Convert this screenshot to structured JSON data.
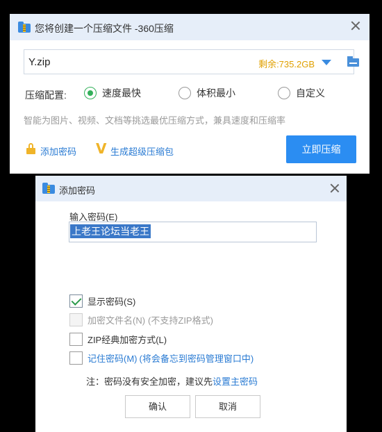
{
  "compress_window": {
    "title": "您将创建一个压缩文件 -360压缩",
    "file_name": "Y.zip",
    "free_space": "剩余:735.2GB",
    "config_label": "压缩配置:",
    "options": [
      "速度最快",
      "体积最小",
      "自定义"
    ],
    "selected_option": "速度最快",
    "description": "智能为图片、视频、文档等挑选最优压缩方式，兼具速度和压缩率",
    "add_password_link": "添加密码",
    "super_package_link": "生成超级压缩包",
    "compress_button": "立即压缩",
    "colors": {
      "accent": "#2b8df2",
      "free_space": "#e0a000",
      "radio_selected": "#33b05a",
      "link": "#2a7bd3"
    }
  },
  "password_dialog": {
    "title": "添加密码",
    "input_label": "输入密码(E)",
    "input_value": "上老王论坛当老王",
    "checkboxes": [
      {
        "label": "显示密码(S)",
        "hint": "",
        "checked": true,
        "enabled": true
      },
      {
        "label": "加密文件名(N)",
        "hint": "(不支持ZIP格式)",
        "checked": false,
        "enabled": false
      },
      {
        "label": "ZIP经典加密方式(L)",
        "hint": "",
        "checked": false,
        "enabled": true
      },
      {
        "label": "记住密码(M)",
        "hint": "(将会备忘到密码管理窗口中)",
        "checked": false,
        "enabled": true
      }
    ],
    "note_text": "注：密码没有安全加密，建议先",
    "note_link": "设置主密码",
    "ok_button": "确认",
    "cancel_button": "取消"
  }
}
